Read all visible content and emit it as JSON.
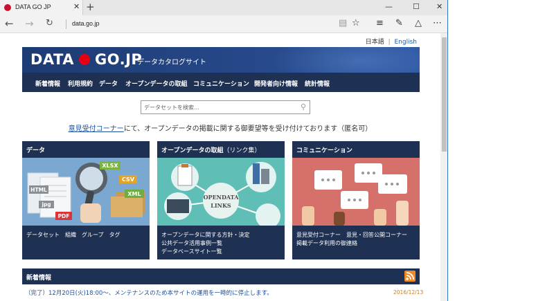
{
  "browser": {
    "tab_title": "DATA GO JP",
    "tab_close": "✕",
    "new_tab": "+",
    "window_controls": [
      "—",
      "☐",
      "✕"
    ],
    "address": "data.go.jp",
    "icons": [
      "back-arrow-icon",
      "forward-arrow-icon",
      "refresh-icon",
      "reading-view-icon",
      "favorite-star-icon",
      "hub-icon",
      "web-note-icon",
      "share-icon",
      "more-icon"
    ]
  },
  "page": {
    "lang": {
      "ja": "日本語",
      "sep": "|",
      "en": "English"
    },
    "logo_left": "DATA",
    "logo_right": "GO.JP",
    "subtitle": "データカタログサイト",
    "menu": [
      "新着情報",
      "利用規約",
      "データ",
      "オープンデータの取組",
      "コミュニケーション",
      "開発者向け情報",
      "統計情報"
    ],
    "search_placeholder": "データセットを検索...",
    "notice_link": "意見受付コーナー",
    "notice_text": "にて、オープンデータの掲載に関する御要望等を受け付けております（匿名可）",
    "cards": [
      {
        "title": "データ",
        "links_rows": [
          [
            "データセット",
            "組織",
            "グループ",
            "タグ"
          ]
        ]
      },
      {
        "title": "オープンデータの取組",
        "title_small": "（リンク集）",
        "links_rows": [
          [
            "オープンデータに関する方針・決定"
          ],
          [
            "公共データ活用事例一覧"
          ],
          [
            "データベースサイト一覧"
          ]
        ]
      },
      {
        "title": "コミュニケーション",
        "links_rows": [
          [
            "意見受付コーナー",
            "意見・回答公開コーナー"
          ],
          [
            "掲載データ利用の御連絡"
          ]
        ]
      }
    ],
    "card_img_labels": {
      "data": [
        "XLSX",
        "CSV",
        "XML",
        "HTML",
        "jpg",
        "PDF"
      ],
      "links": [
        "OPENDATA",
        "LINKS"
      ]
    },
    "news_title": "新着情報",
    "news_item": "（完了）12月20日(火)18:00～、メンテナンスのため本サイトの運用を一時的に停止します。",
    "news_date": "2016/12/13"
  },
  "colors": {
    "navy": "#1f3152",
    "banner": "#1d3b73",
    "red": "#e60012",
    "link": "#1a4f9c",
    "rss": "#f08a24"
  }
}
